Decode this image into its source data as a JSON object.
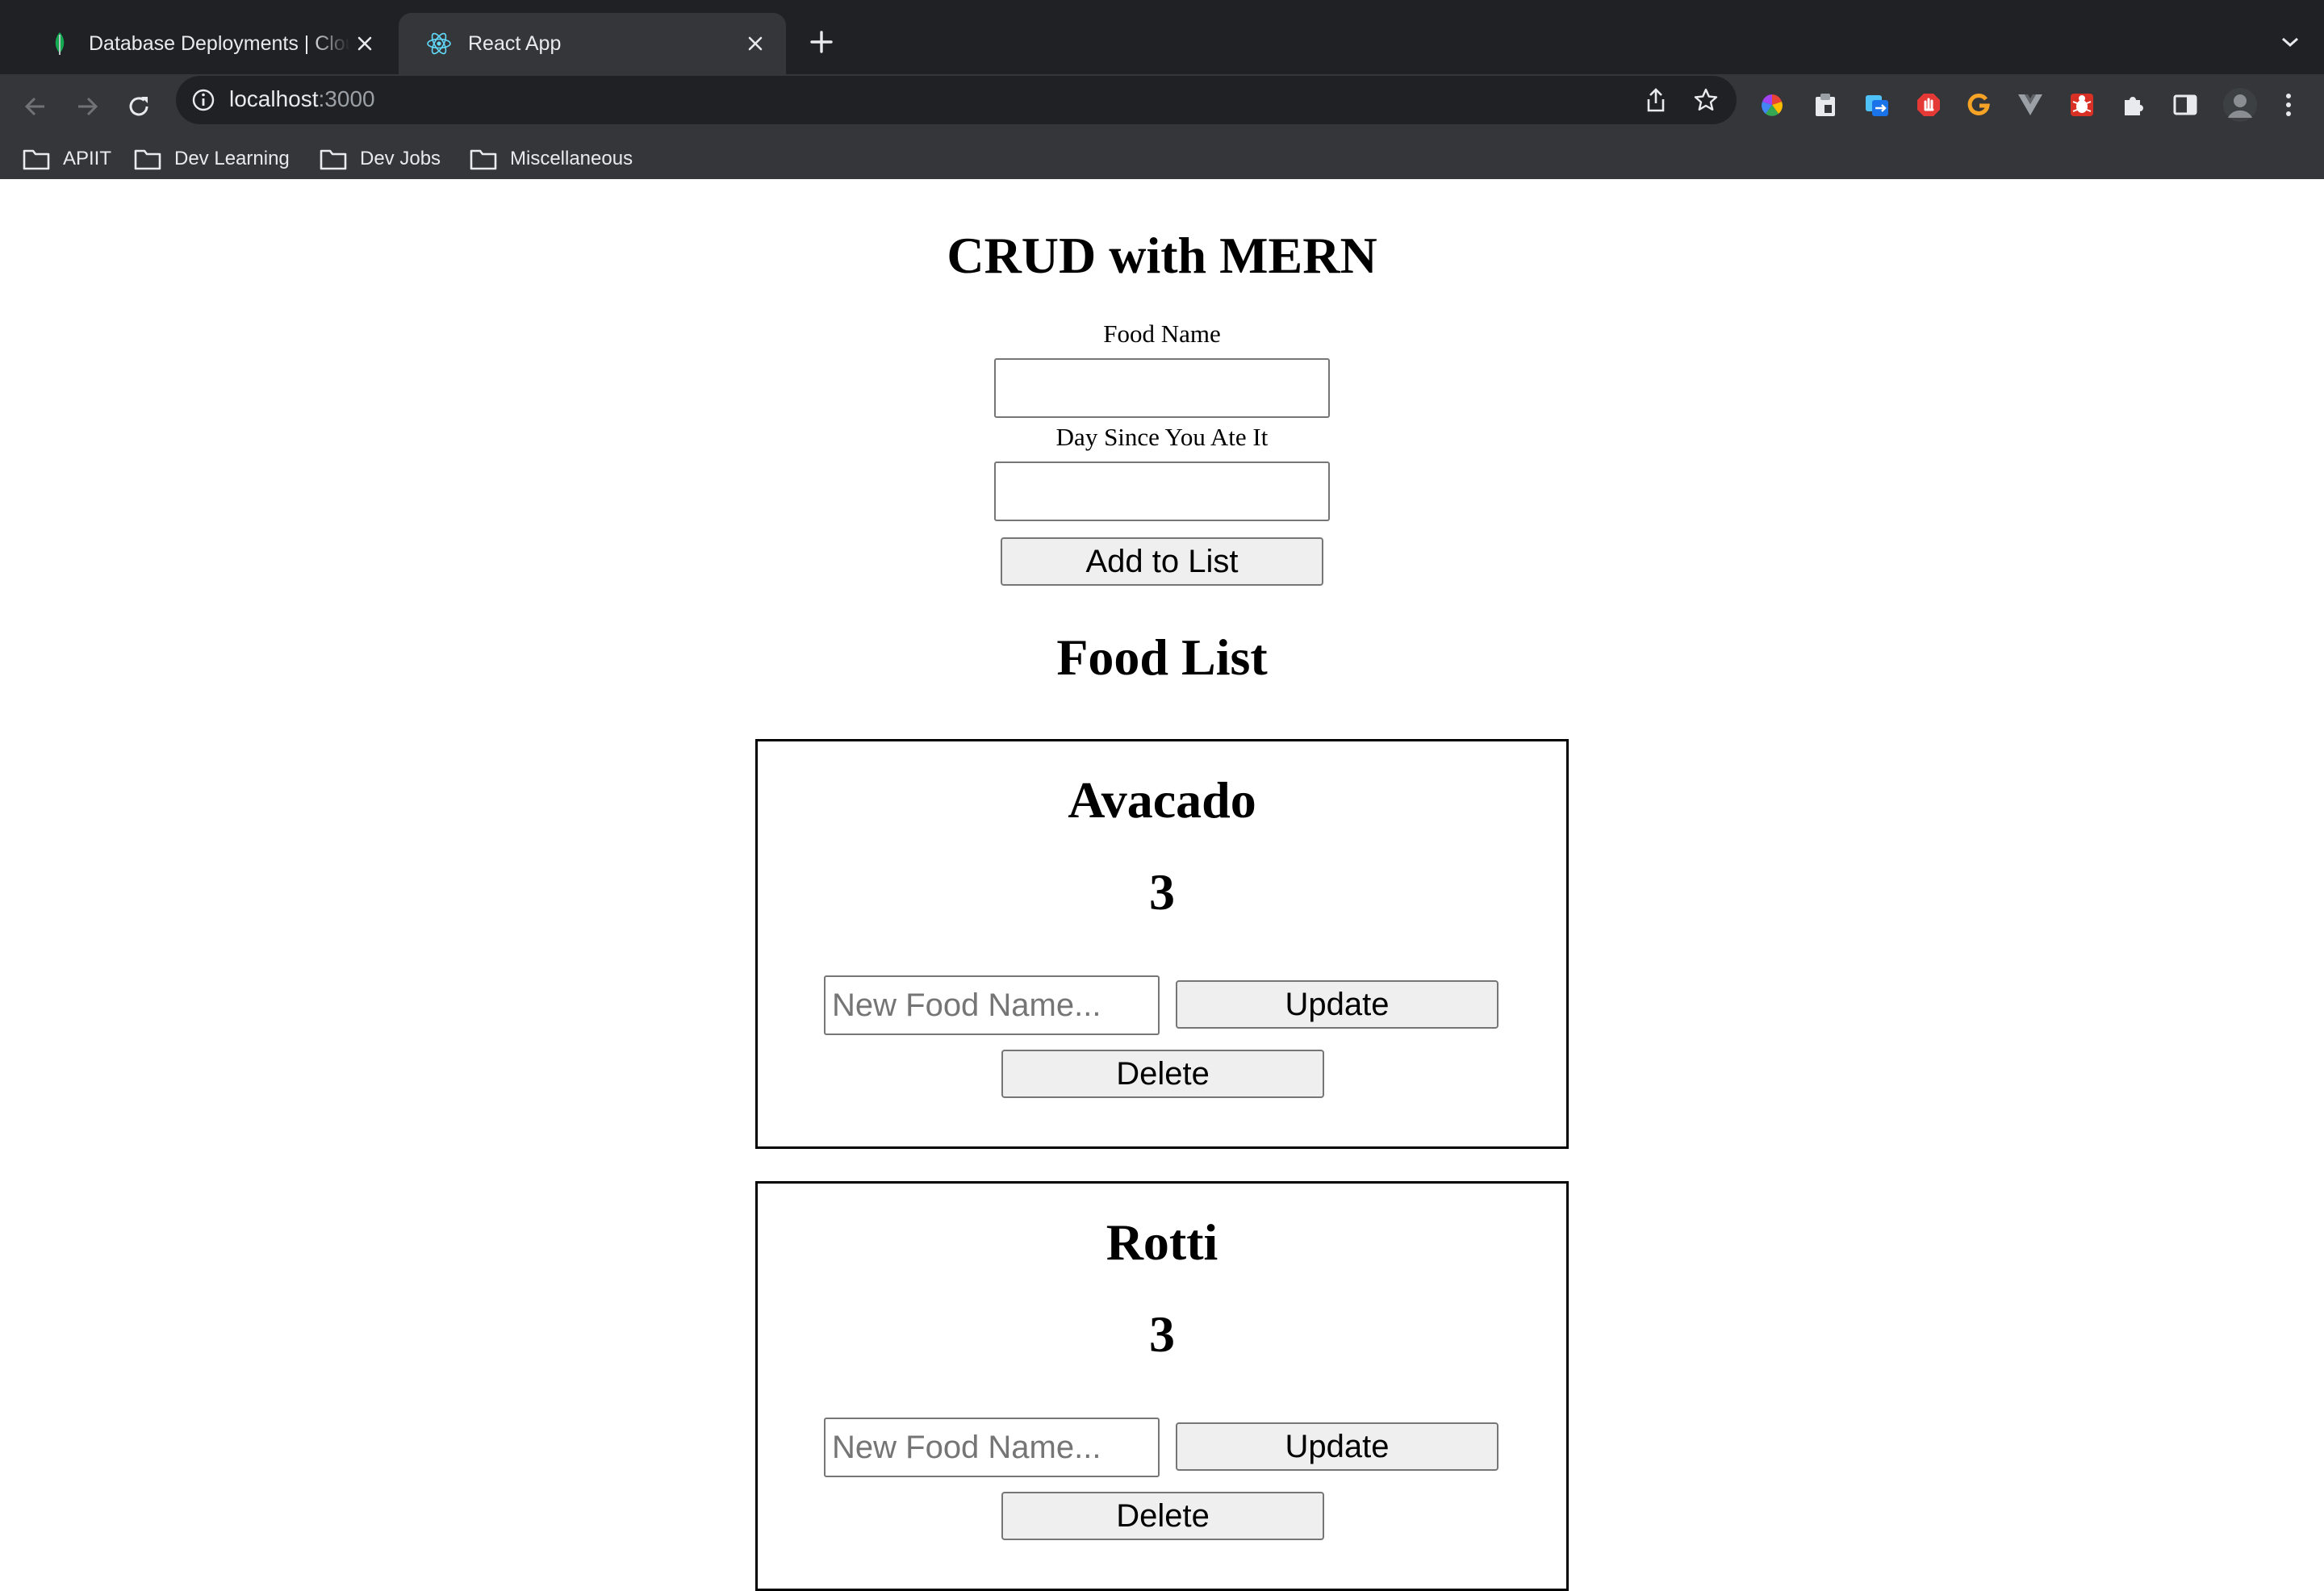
{
  "browser": {
    "tabs": [
      {
        "title": "Database Deployments | Cloud",
        "active": false,
        "favicon": "mongodb-leaf-icon"
      },
      {
        "title": "React App",
        "active": true,
        "favicon": "react-icon"
      }
    ],
    "url_host": "localhost",
    "url_port": ":3000",
    "bookmarks": [
      "APIIT",
      "Dev Learning",
      "Dev Jobs",
      "Miscellaneous"
    ],
    "extensions": [
      "color-wheel-extension-icon",
      "clipboard-extension-icon",
      "translate-extension-icon",
      "adblock-extension-icon",
      "grammarly-extension-icon",
      "vue-devtools-extension-icon",
      "bug-extension-icon",
      "puzzle-extensions-icon",
      "side-panel-icon",
      "profile-avatar",
      "kebab-menu-icon"
    ]
  },
  "app": {
    "title": "CRUD with MERN",
    "food_name_label": "Food Name",
    "food_name_value": "",
    "days_label": "Day Since You Ate It",
    "days_value": "",
    "add_button": "Add to List",
    "list_title": "Food List",
    "items": [
      {
        "name": "Avacado",
        "days": "3",
        "new_name_placeholder": "New Food Name...",
        "update_label": "Update",
        "delete_label": "Delete"
      },
      {
        "name": "Rotti",
        "days": "3",
        "new_name_placeholder": "New Food Name...",
        "update_label": "Update",
        "delete_label": "Delete"
      }
    ]
  }
}
